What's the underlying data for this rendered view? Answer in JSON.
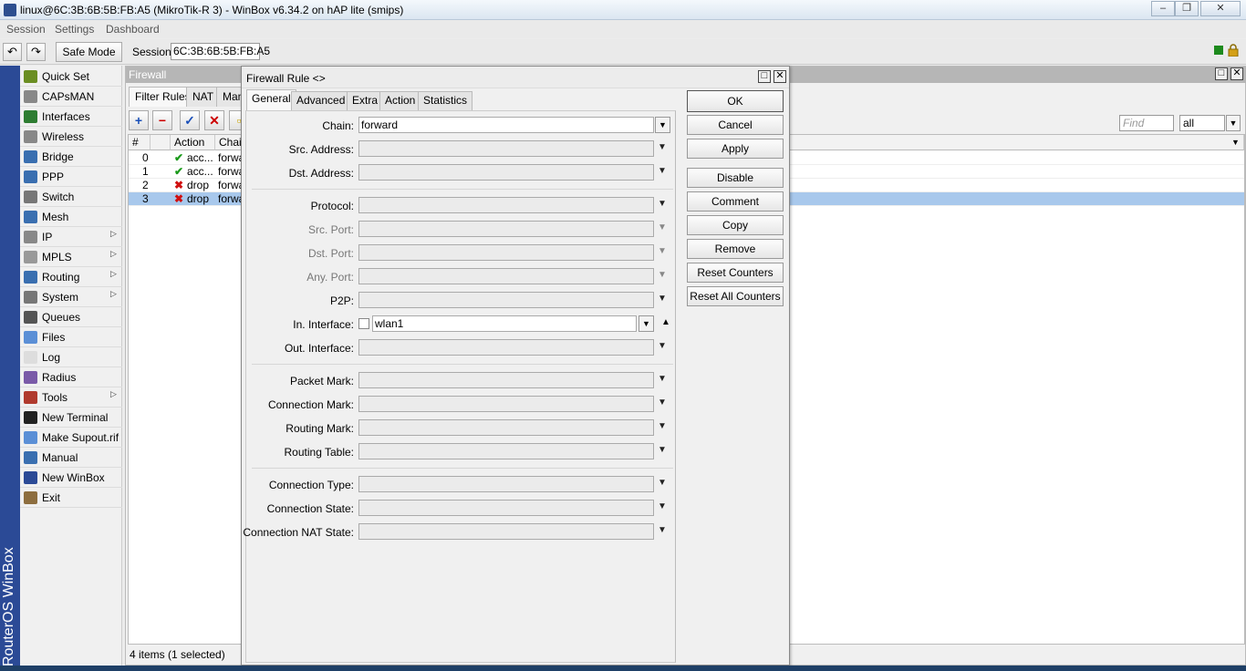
{
  "window": {
    "title": "linux@6C:3B:6B:5B:FB:A5 (MikroTik-R 3) - WinBox v6.34.2 on hAP lite (smips)",
    "minimize": "–",
    "maximize": "❐",
    "close": "✕"
  },
  "menu": [
    "Session",
    "Settings",
    "Dashboard"
  ],
  "toolbar": {
    "undo": "↶",
    "redo": "↷",
    "safe_mode": "Safe Mode",
    "session_label": "Session:",
    "session_value": "6C:3B:6B:5B:FB:A5"
  },
  "brand": "RouterOS WinBox",
  "sidebar": [
    {
      "label": "Quick Set",
      "icon": "quick-set-icon",
      "color": "#6b8e23",
      "submenu": false
    },
    {
      "label": "CAPsMAN",
      "icon": "capsman-icon",
      "color": "#888888",
      "submenu": false
    },
    {
      "label": "Interfaces",
      "icon": "interfaces-icon",
      "color": "#2e7d32",
      "submenu": false
    },
    {
      "label": "Wireless",
      "icon": "wireless-icon",
      "color": "#888888",
      "submenu": false
    },
    {
      "label": "Bridge",
      "icon": "bridge-icon",
      "color": "#3a6fb0",
      "submenu": false
    },
    {
      "label": "PPP",
      "icon": "ppp-icon",
      "color": "#3a6fb0",
      "submenu": false
    },
    {
      "label": "Switch",
      "icon": "switch-icon",
      "color": "#777777",
      "submenu": false
    },
    {
      "label": "Mesh",
      "icon": "mesh-icon",
      "color": "#3a6fb0",
      "submenu": false
    },
    {
      "label": "IP",
      "icon": "ip-icon",
      "color": "#888888",
      "submenu": true
    },
    {
      "label": "MPLS",
      "icon": "mpls-icon",
      "color": "#999999",
      "submenu": true
    },
    {
      "label": "Routing",
      "icon": "routing-icon",
      "color": "#3a6fb0",
      "submenu": true
    },
    {
      "label": "System",
      "icon": "system-icon",
      "color": "#777777",
      "submenu": true
    },
    {
      "label": "Queues",
      "icon": "queues-icon",
      "color": "#555555",
      "submenu": false
    },
    {
      "label": "Files",
      "icon": "files-icon",
      "color": "#5b8fd6",
      "submenu": false
    },
    {
      "label": "Log",
      "icon": "log-icon",
      "color": "#dddddd",
      "submenu": false
    },
    {
      "label": "Radius",
      "icon": "radius-icon",
      "color": "#7a5aa8",
      "submenu": false
    },
    {
      "label": "Tools",
      "icon": "tools-icon",
      "color": "#b03a2e",
      "submenu": true
    },
    {
      "label": "New Terminal",
      "icon": "terminal-icon",
      "color": "#222222",
      "submenu": false
    },
    {
      "label": "Make Supout.rif",
      "icon": "supout-icon",
      "color": "#5b8fd6",
      "submenu": false
    },
    {
      "label": "Manual",
      "icon": "manual-icon",
      "color": "#3a6fb0",
      "submenu": false
    },
    {
      "label": "New WinBox",
      "icon": "winbox-icon",
      "color": "#2b4a96",
      "submenu": false
    },
    {
      "label": "Exit",
      "icon": "exit-icon",
      "color": "#8d6e3f",
      "submenu": false
    }
  ],
  "firewall": {
    "title": "Firewall",
    "tabs": [
      "Filter Rules",
      "NAT",
      "Man"
    ],
    "find_placeholder": "Find",
    "filter_value": "all",
    "columns": [
      "#",
      "",
      "Action",
      "Chain"
    ],
    "rows": [
      {
        "num": "0",
        "action": "acc...",
        "chain": "forwa",
        "kind": "accept",
        "selected": false
      },
      {
        "num": "1",
        "action": "acc...",
        "chain": "forwa",
        "kind": "accept",
        "selected": false
      },
      {
        "num": "2",
        "action": "drop",
        "chain": "forwa",
        "kind": "drop",
        "selected": false
      },
      {
        "num": "3",
        "action": "drop",
        "chain": "forwa",
        "kind": "drop",
        "selected": true
      }
    ],
    "footer": "4 items (1 selected)"
  },
  "dialog": {
    "title": "Firewall Rule <>",
    "tabs": [
      "General",
      "Advanced",
      "Extra",
      "Action",
      "Statistics"
    ],
    "fields": {
      "chain": {
        "label": "Chain:",
        "value": "forward"
      },
      "src_address": {
        "label": "Src. Address:",
        "value": ""
      },
      "dst_address": {
        "label": "Dst. Address:",
        "value": ""
      },
      "protocol": {
        "label": "Protocol:",
        "value": ""
      },
      "src_port": {
        "label": "Src. Port:",
        "value": ""
      },
      "dst_port": {
        "label": "Dst. Port:",
        "value": ""
      },
      "any_port": {
        "label": "Any. Port:",
        "value": ""
      },
      "p2p": {
        "label": "P2P:",
        "value": ""
      },
      "in_interface": {
        "label": "In. Interface:",
        "value": "wlan1"
      },
      "out_interface": {
        "label": "Out. Interface:",
        "value": ""
      },
      "packet_mark": {
        "label": "Packet Mark:",
        "value": ""
      },
      "connection_mark": {
        "label": "Connection Mark:",
        "value": ""
      },
      "routing_mark": {
        "label": "Routing Mark:",
        "value": ""
      },
      "routing_table": {
        "label": "Routing Table:",
        "value": ""
      },
      "connection_type": {
        "label": "Connection Type:",
        "value": ""
      },
      "connection_state": {
        "label": "Connection State:",
        "value": ""
      },
      "connection_nat_state": {
        "label": "Connection NAT State:",
        "value": ""
      }
    },
    "buttons": {
      "ok": "OK",
      "cancel": "Cancel",
      "apply": "Apply",
      "disable": "Disable",
      "comment": "Comment",
      "copy": "Copy",
      "remove": "Remove",
      "reset_counters": "Reset Counters",
      "reset_all_counters": "Reset All Counters"
    }
  }
}
